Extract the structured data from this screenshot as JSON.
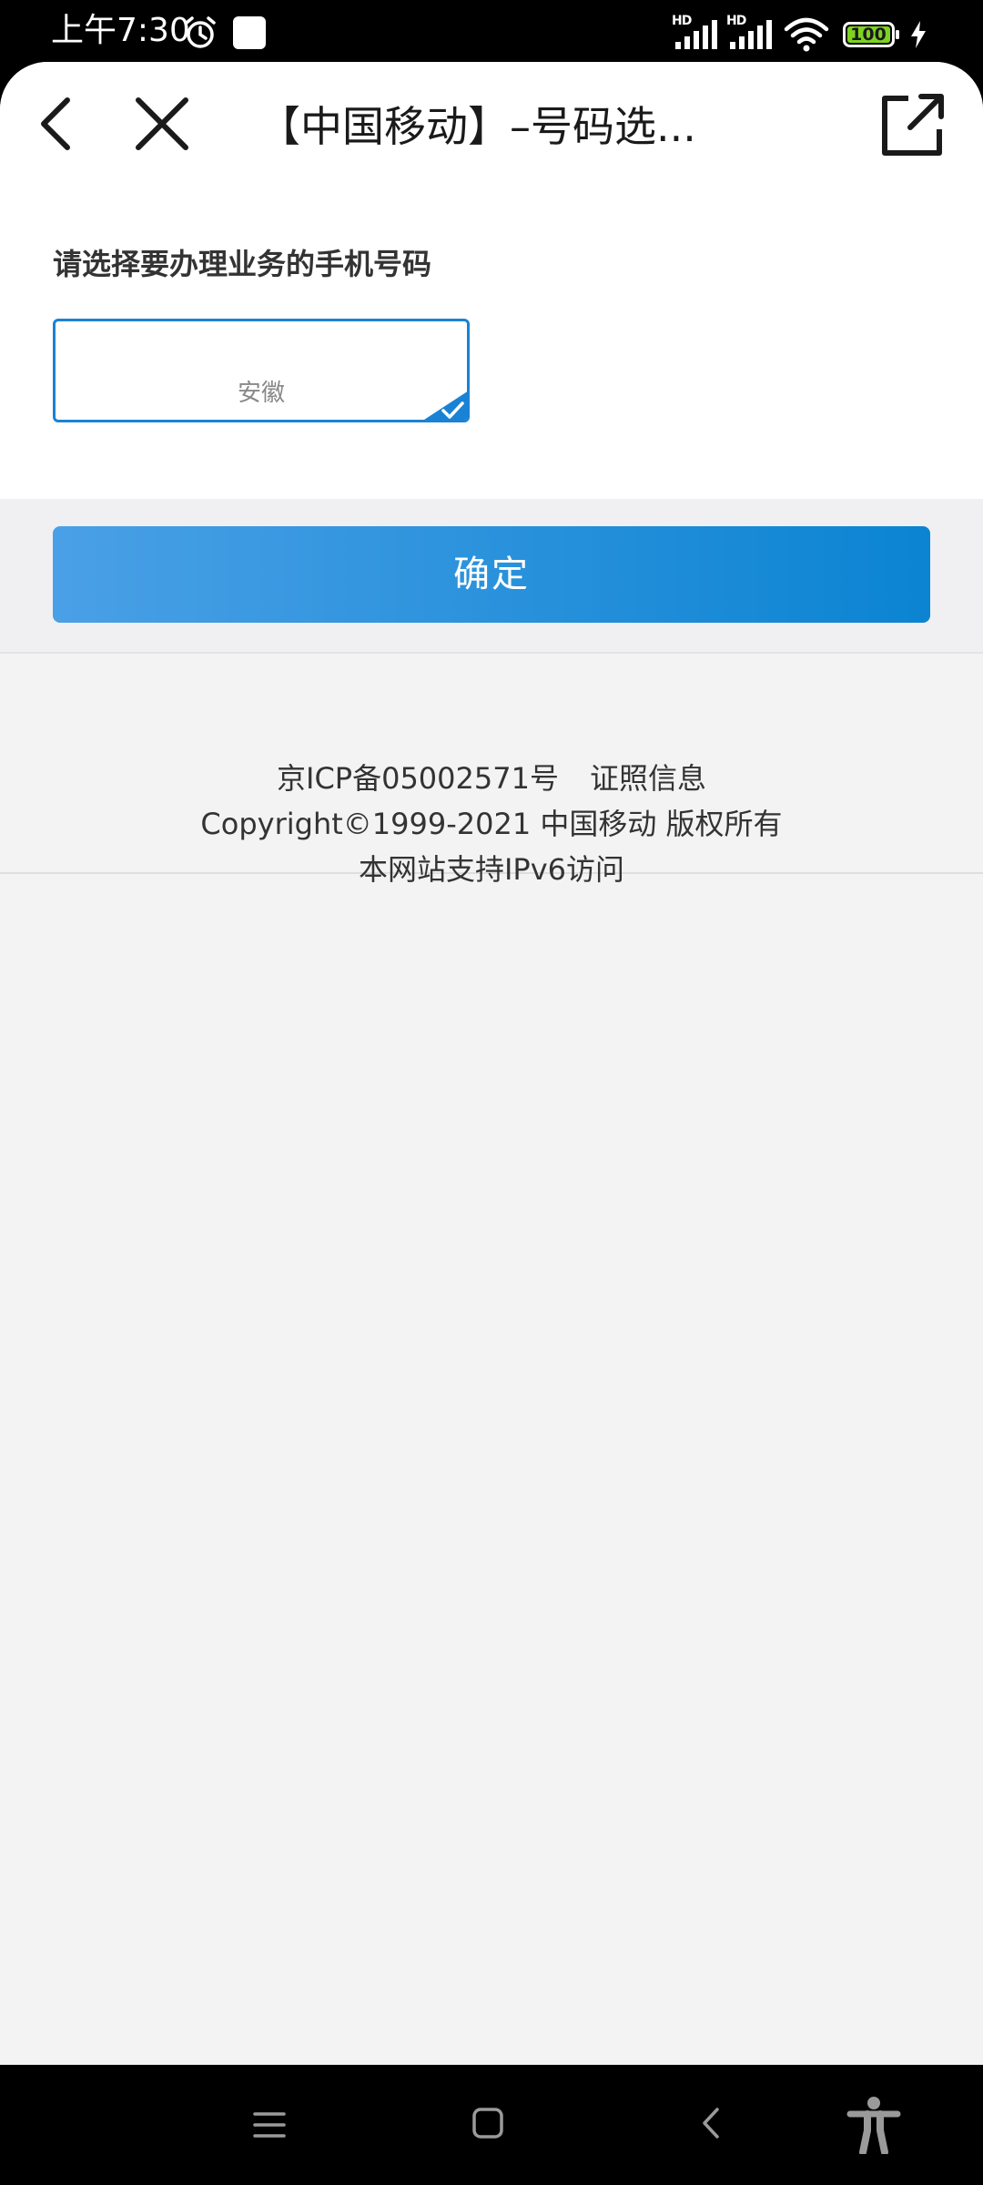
{
  "status_bar": {
    "time": "上午7:30",
    "signal_1_label": "HD",
    "signal_2_label": "HD",
    "battery_level": "100",
    "icons": [
      "alarm-icon",
      "notification-icon",
      "signal-icon",
      "signal-icon",
      "wifi-icon",
      "battery-icon",
      "charging-icon"
    ]
  },
  "top_bar": {
    "title": "【中国移动】–号码选...",
    "icons": [
      "back-arrow-icon",
      "close-icon",
      "share-icon"
    ]
  },
  "content": {
    "label": "请选择要办理业务的手机号码",
    "selected_number_card": {
      "location": "安徽",
      "selected": true
    }
  },
  "confirm_button": {
    "label": "确定"
  },
  "footer": {
    "icp": "京ICP备05002571号",
    "license_link": "证照信息",
    "copyright": "Copyright©1999-2021 中国移动 版权所有",
    "ipv6": "本网站支持IPv6访问"
  },
  "nav_bar": {
    "icons": [
      "menu-icon",
      "home-icon",
      "back-icon",
      "accessibility-icon"
    ]
  },
  "colors": {
    "accent": "#1a82d4",
    "button_gradient_start": "#4aa0e6",
    "button_gradient_end": "#0b84d2",
    "battery_fill": "#7ed321"
  }
}
